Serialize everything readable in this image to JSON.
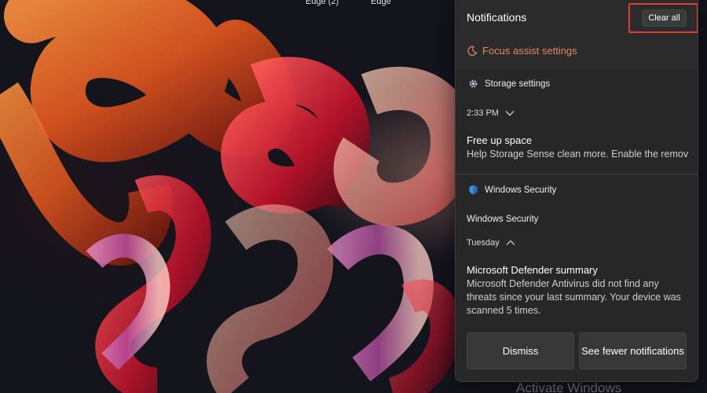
{
  "desktop": {
    "icon_labels": [
      "Edge (2)",
      "Edge"
    ],
    "watermark": "Activate Windows"
  },
  "panel": {
    "title": "Notifications",
    "clear_all_label": "Clear all",
    "focus_assist_label": "Focus assist settings",
    "accent_color": "#e58a61",
    "highlight_color": "#e03c3c"
  },
  "storage": {
    "app_name": "Storage settings",
    "app_icon": "gear-icon",
    "time": "2:33 PM",
    "time_chevron": "chevron-down-icon",
    "title": "Free up space",
    "body": "Help Storage Sense clean more. Enable the remov"
  },
  "security": {
    "app_name": "Windows Security",
    "app_icon": "shield-icon",
    "subtitle": "Windows Security",
    "time": "Tuesday",
    "time_chevron": "chevron-up-icon",
    "title": "Microsoft Defender summary",
    "body": "Microsoft Defender Antivirus did not find any threats since your last summary. Your device was scanned 5 times.",
    "actions": {
      "dismiss": "Dismiss",
      "fewer": "See fewer notifications"
    }
  }
}
